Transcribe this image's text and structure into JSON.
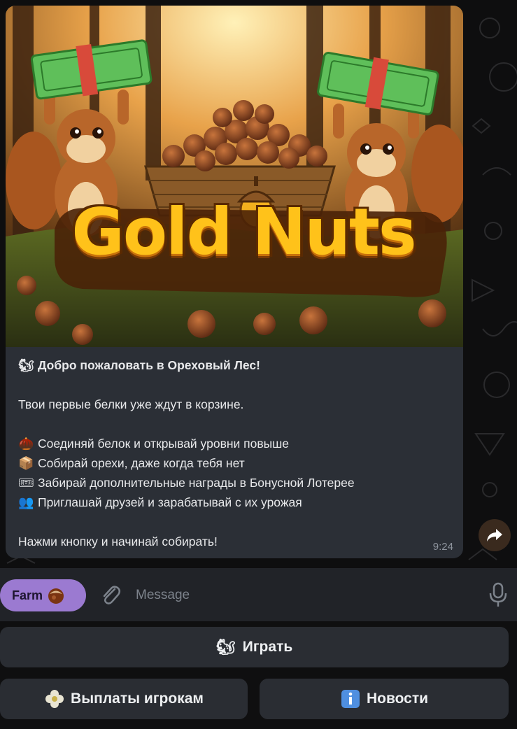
{
  "message": {
    "image_logo_text": "Gold Nuts",
    "welcome_title": "Добро пожаловать в Ореховый Лес!",
    "intro": "Твои первые белки уже ждут в корзине.",
    "features": [
      "Соединяй белок и открывай уровни повыше",
      "Собирай орехи, даже когда тебя нет",
      "Забирай дополнительные награды в Бонусной Лотерее",
      "Приглашай друзей и зарабатывай с их урожая"
    ],
    "outro": "Нажми кнопку и начинай собирать!",
    "time": "9:24",
    "emojis": {
      "title": "🐿",
      "features": [
        "🌰",
        "📦",
        "🎟",
        "👥"
      ]
    }
  },
  "composer": {
    "farm_button_label": "Farm",
    "message_placeholder": "Message"
  },
  "keyboard": {
    "play_label": "Играть",
    "payouts_label": "Выплаты игрокам",
    "news_label": "Новости"
  },
  "colors": {
    "bubble": "#2b2f36",
    "farm_button": "#9b7ad1",
    "keyboard_button": "#2a2d33",
    "logo_gold": "#ffc21a"
  },
  "icons": [
    "squirrel-icon",
    "chestnut-icon",
    "box-icon",
    "ticket-icon",
    "people-icon",
    "forward-icon",
    "paperclip-icon",
    "microphone-icon",
    "flower-icon",
    "info-icon"
  ]
}
